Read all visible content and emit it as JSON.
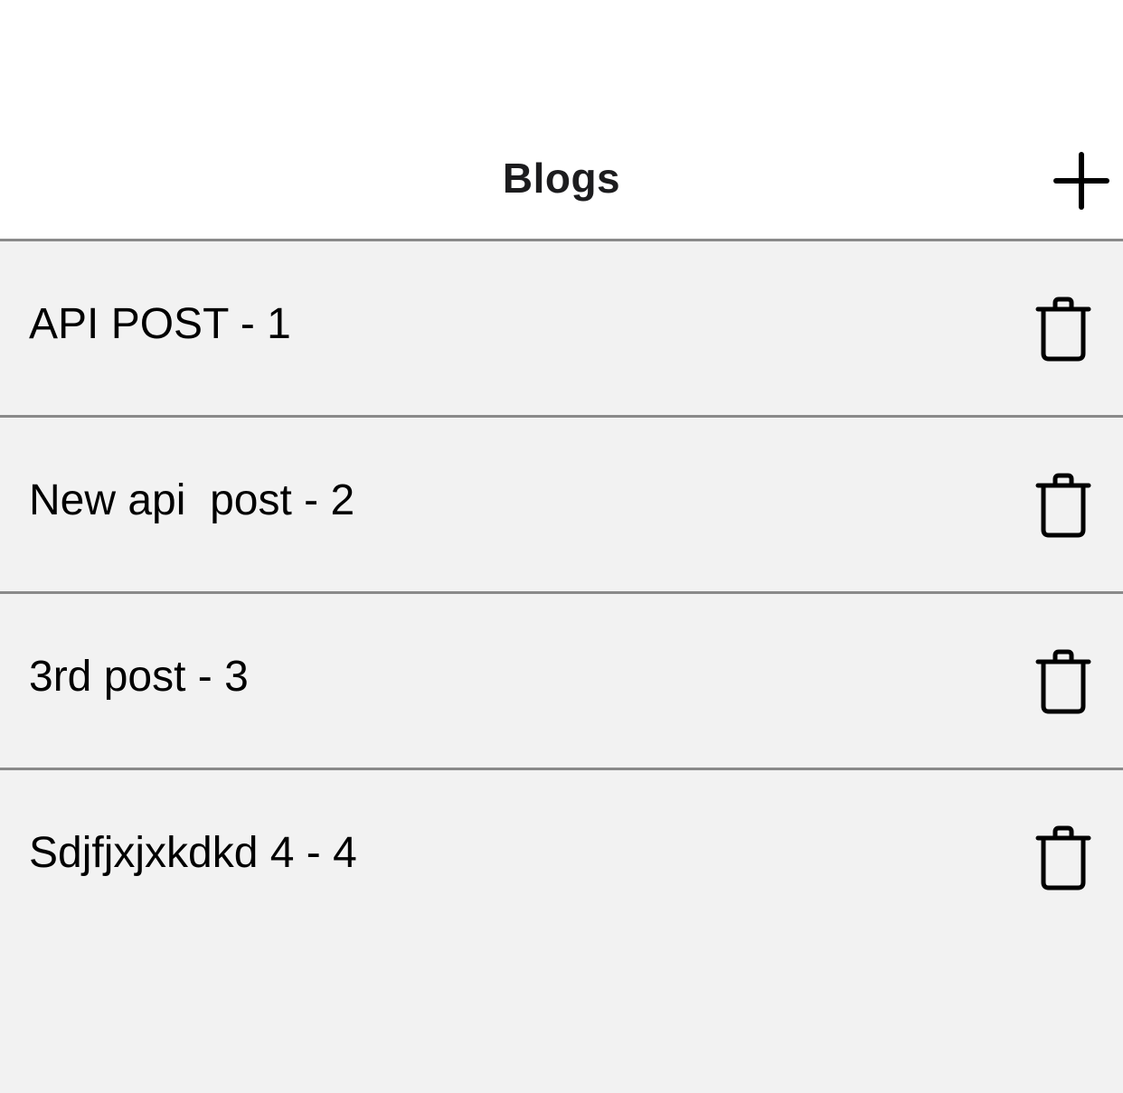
{
  "header": {
    "title": "Blogs",
    "add_icon": "plus-icon"
  },
  "blogs": [
    {
      "label": "API POST - 1",
      "delete_icon": "trash-icon"
    },
    {
      "label": "New api  post - 2",
      "delete_icon": "trash-icon"
    },
    {
      "label": "3rd post - 3",
      "delete_icon": "trash-icon"
    },
    {
      "label": "Sdjfjxjxkdkd 4 - 4",
      "delete_icon": "trash-icon"
    }
  ],
  "colors": {
    "list_background": "#f2f2f2",
    "header_background": "#ffffff",
    "divider": "#8a8a8a",
    "text": "#000000"
  }
}
